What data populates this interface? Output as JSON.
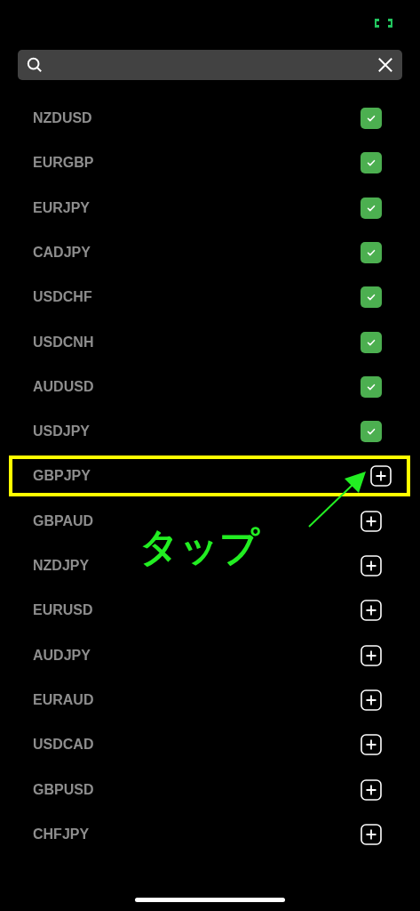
{
  "pairs": [
    {
      "name": "NZDUSD",
      "added": true,
      "highlighted": false
    },
    {
      "name": "EURGBP",
      "added": true,
      "highlighted": false
    },
    {
      "name": "EURJPY",
      "added": true,
      "highlighted": false
    },
    {
      "name": "CADJPY",
      "added": true,
      "highlighted": false
    },
    {
      "name": "USDCHF",
      "added": true,
      "highlighted": false
    },
    {
      "name": "USDCNH",
      "added": true,
      "highlighted": false
    },
    {
      "name": "AUDUSD",
      "added": true,
      "highlighted": false
    },
    {
      "name": "USDJPY",
      "added": true,
      "highlighted": false
    },
    {
      "name": "GBPJPY",
      "added": false,
      "highlighted": true
    },
    {
      "name": "GBPAUD",
      "added": false,
      "highlighted": false
    },
    {
      "name": "NZDJPY",
      "added": false,
      "highlighted": false
    },
    {
      "name": "EURUSD",
      "added": false,
      "highlighted": false
    },
    {
      "name": "AUDJPY",
      "added": false,
      "highlighted": false
    },
    {
      "name": "EURAUD",
      "added": false,
      "highlighted": false
    },
    {
      "name": "USDCAD",
      "added": false,
      "highlighted": false
    },
    {
      "name": "GBPUSD",
      "added": false,
      "highlighted": false
    },
    {
      "name": "CHFJPY",
      "added": false,
      "highlighted": false
    }
  ],
  "annotation": {
    "label": "タップ"
  }
}
